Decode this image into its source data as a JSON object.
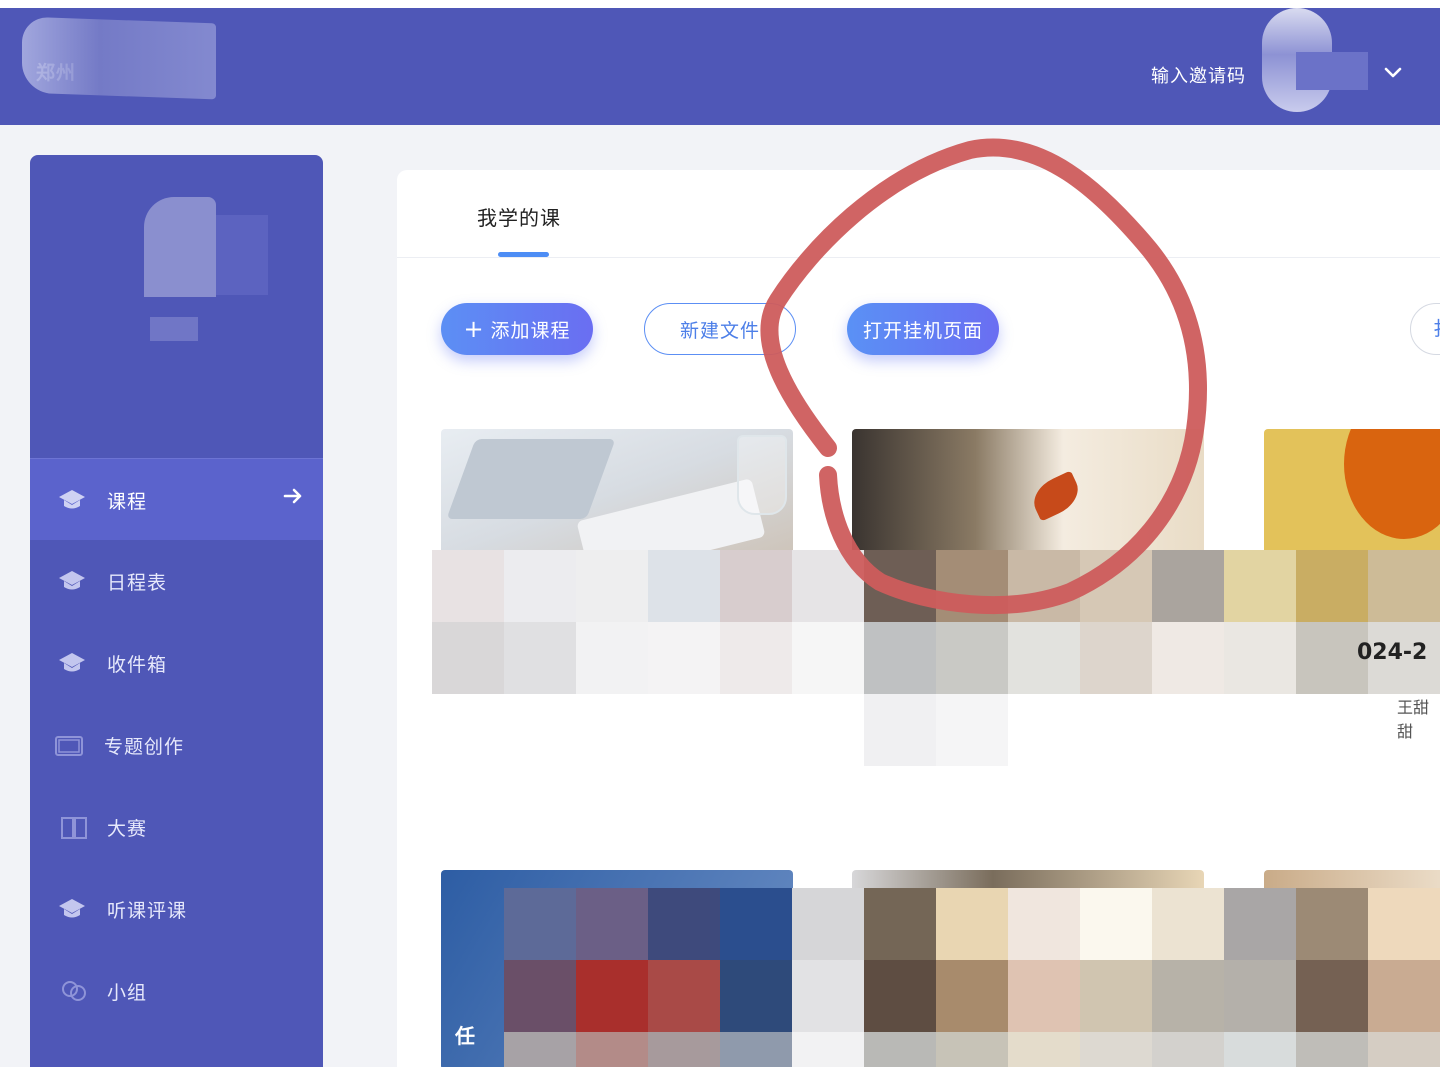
{
  "header": {
    "logo_text": "郑州",
    "invite_label": "输入邀请码",
    "dropdown_icon": "chevron-down-icon"
  },
  "sidebar": {
    "items": [
      {
        "label": "课程",
        "icon": "graduation-cap-icon",
        "active": true
      },
      {
        "label": "日程表",
        "icon": "graduation-cap-icon"
      },
      {
        "label": "收件箱",
        "icon": "graduation-cap-icon"
      },
      {
        "label": "专题创作",
        "icon": "window-icon"
      },
      {
        "label": "大赛",
        "icon": "book-icon"
      },
      {
        "label": "听课评课",
        "icon": "graduation-cap-icon"
      },
      {
        "label": "小组",
        "icon": "group-icon"
      }
    ]
  },
  "main": {
    "tab_label": "我学的课",
    "buttons": {
      "add_course": "添加课程",
      "new_folder": "新建文件",
      "open_hang": "打开挂机页面",
      "edge_button": "扌"
    },
    "cards": {
      "teacher_fragment": "王甜甜",
      "date_fragment": "024-2",
      "cover_text_fragment": "任"
    }
  },
  "colors": {
    "header_bg": "#4f57b7",
    "sidebar_active": "#5b63cc",
    "accent_blue": "#5c8ff4",
    "annotation_red": "#cd5c5c"
  }
}
